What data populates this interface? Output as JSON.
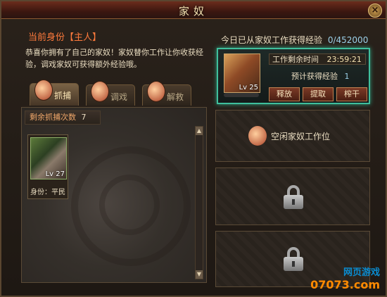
{
  "window": {
    "title": "家奴",
    "close_label": "×"
  },
  "left": {
    "identity": "当前身份【主人】",
    "intro": "恭喜你拥有了自己的家奴！家奴替你工作让你收获经验，调戏家奴可获得额外经验哦。",
    "tabs": [
      {
        "label": "抓捕",
        "active": true
      },
      {
        "label": "调戏",
        "active": false
      },
      {
        "label": "解救",
        "active": false
      }
    ],
    "catch_remaining_label": "剩余抓捕次数",
    "catch_remaining_value": "7",
    "slave": {
      "level": "Lv 27",
      "identity": "身份：平民"
    },
    "scroll_up": "▲",
    "scroll_down": "▼"
  },
  "right": {
    "exp_label": "今日已从家奴工作获得经验",
    "exp_value": "0/452000",
    "worker": {
      "level": "Lv 25",
      "progress": 0.0,
      "time_label": "工作剩余时间",
      "time_value": "23:59:21",
      "predict_label": "预计获得经验",
      "predict_value": "1",
      "buttons": [
        "释放",
        "提取",
        "榨干"
      ]
    },
    "empty_slot_label": "空闲家奴工作位"
  },
  "watermark": {
    "line1": "网页游戏",
    "line2": "07073.com"
  }
}
